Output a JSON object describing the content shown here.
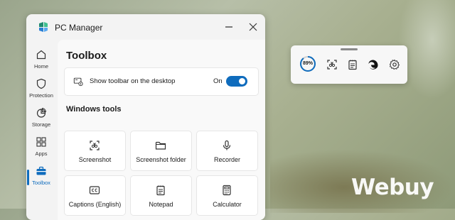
{
  "window": {
    "title": "PC Manager",
    "minimize_icon": "minimize-icon",
    "close_icon": "close-icon"
  },
  "nav": [
    {
      "label": "Home",
      "icon": "home-icon"
    },
    {
      "label": "Protection",
      "icon": "shield-icon"
    },
    {
      "label": "Storage",
      "icon": "pie-chart-icon"
    },
    {
      "label": "Apps",
      "icon": "apps-grid-icon"
    },
    {
      "label": "Toolbox",
      "icon": "toolbox-icon",
      "active": true
    }
  ],
  "page": {
    "title": "Toolbox",
    "toolbar_setting": {
      "label": "Show toolbar on the desktop",
      "state": "On",
      "enabled": true
    },
    "section_title": "Windows tools",
    "tools": [
      {
        "label": "Screenshot",
        "icon": "screenshot-icon"
      },
      {
        "label": "Screenshot folder",
        "icon": "folder-icon"
      },
      {
        "label": "Recorder",
        "icon": "microphone-icon"
      },
      {
        "label": "Captions (English)",
        "icon": "captions-icon"
      },
      {
        "label": "Notepad",
        "icon": "notepad-icon"
      },
      {
        "label": "Calculator",
        "icon": "calculator-icon"
      }
    ]
  },
  "floating_toolbar": {
    "memory_usage": "89%",
    "memory_fraction": 0.89
  },
  "watermark": "Webuy",
  "colors": {
    "accent": "#0f6cbd"
  }
}
